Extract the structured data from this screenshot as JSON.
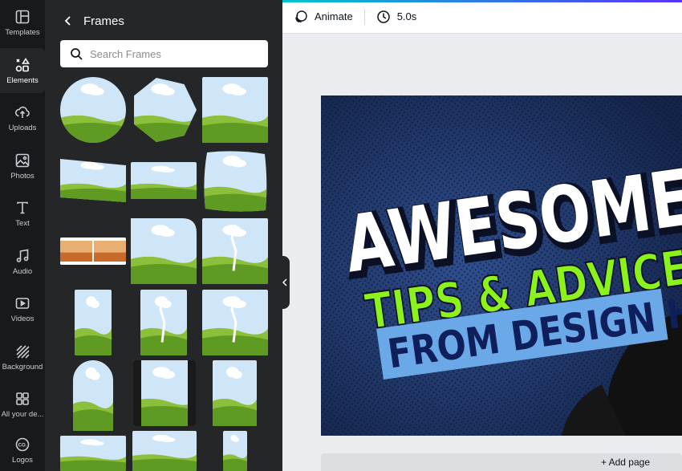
{
  "sidebar": {
    "items": [
      {
        "label": "Templates",
        "icon": "templates-icon"
      },
      {
        "label": "Elements",
        "icon": "elements-icon",
        "active": true
      },
      {
        "label": "Uploads",
        "icon": "uploads-icon"
      },
      {
        "label": "Photos",
        "icon": "photos-icon"
      },
      {
        "label": "Text",
        "icon": "text-icon"
      },
      {
        "label": "Audio",
        "icon": "audio-icon"
      },
      {
        "label": "Videos",
        "icon": "videos-icon"
      },
      {
        "label": "Background",
        "icon": "background-icon"
      },
      {
        "label": "All your de...",
        "icon": "all-your-designs-icon"
      },
      {
        "label": "Logos",
        "icon": "logos-icon"
      }
    ]
  },
  "panel": {
    "title": "Frames",
    "search": {
      "placeholder": "Search Frames",
      "value": ""
    }
  },
  "toolbar": {
    "animate_label": "Animate",
    "duration": "5.0s"
  },
  "canvas": {
    "line1": "AWESOME",
    "line2": "TIPS & ADVICE",
    "line3": "FROM DESIGN HUB"
  },
  "add_page_label": "+ Add page",
  "colors": {
    "rail_bg": "#18191b",
    "panel_bg": "#252627",
    "accent_green": "#8cf21b",
    "banner_blue": "#6aa8e8",
    "canvas_navy": "#1e3567"
  }
}
